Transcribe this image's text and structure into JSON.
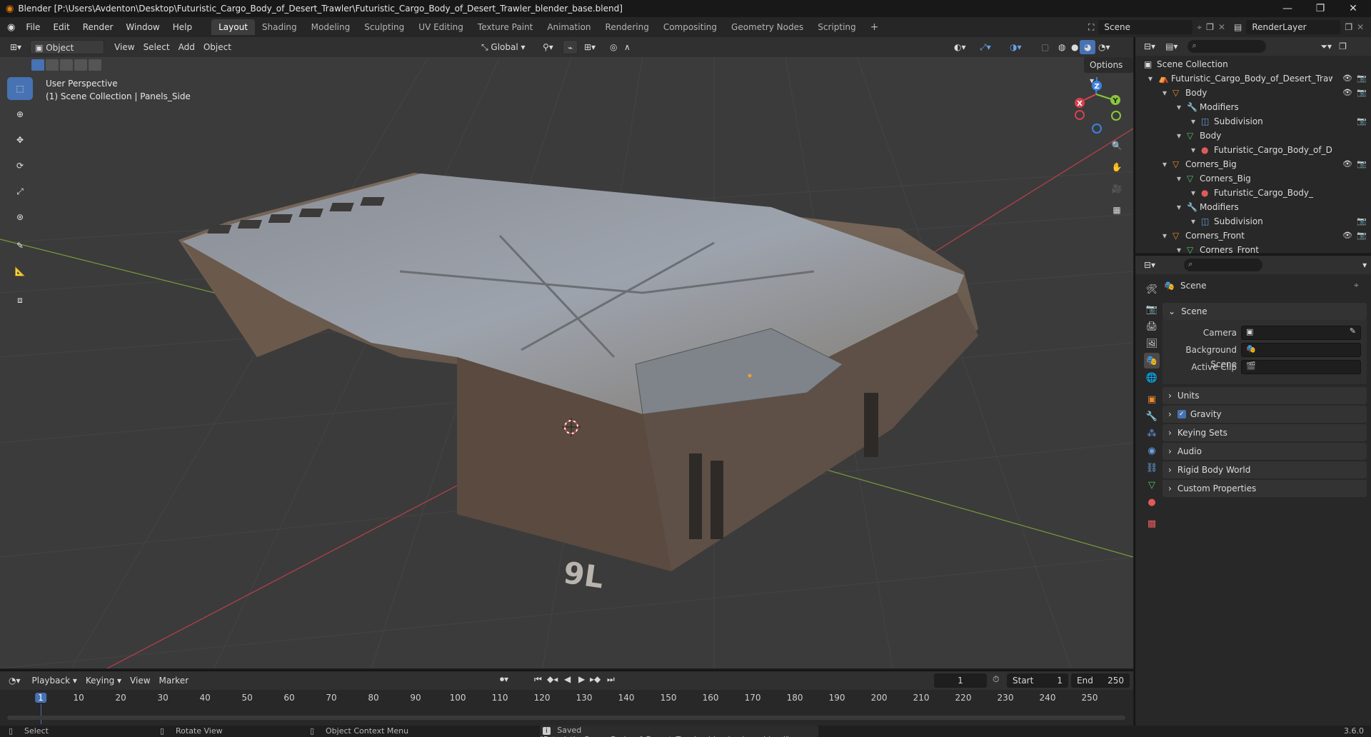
{
  "titlebar": {
    "title": "Blender [P:\\Users\\Avdenton\\Desktop\\Futuristic_Cargo_Body_of_Desert_Trawler\\Futuristic_Cargo_Body_of_Desert_Trawler_blender_base.blend]",
    "minimize": "—",
    "maximize": "❐",
    "close": "✕"
  },
  "menubar": {
    "items": [
      "File",
      "Edit",
      "Render",
      "Window",
      "Help"
    ],
    "workspaces": [
      "Layout",
      "Shading",
      "Modeling",
      "Sculpting",
      "UV Editing",
      "Texture Paint",
      "Animation",
      "Rendering",
      "Compositing",
      "Geometry Nodes",
      "Scripting"
    ],
    "active_workspace": "Layout",
    "add_tab": "+",
    "scene_label": "Scene",
    "render_layer_label": "RenderLayer"
  },
  "viewport_header": {
    "mode": "Object Mode",
    "menus": [
      "View",
      "Select",
      "Add",
      "Object"
    ],
    "transform_orientation": "Global",
    "options_label": "Options"
  },
  "viewport": {
    "perspective_label": "User Perspective",
    "collection_label": "(1) Scene Collection | Panels_Side",
    "gizmo_axes": [
      "X",
      "Y",
      "Z"
    ],
    "decal_text": "9L"
  },
  "outliner": {
    "rows": [
      {
        "label": "Scene Collection",
        "icon": "collection-icon",
        "indent": 0
      },
      {
        "label": "Futuristic_Cargo_Body_of_Desert_Trawl",
        "icon": "object-icon",
        "indent": 1,
        "eye": true,
        "cam": true
      },
      {
        "label": "Body",
        "icon": "mesh-object-icon",
        "indent": 2,
        "eye": true,
        "cam": true
      },
      {
        "label": "Modifiers",
        "icon": "wrench-icon",
        "indent": 3
      },
      {
        "label": "Subdivision",
        "icon": "subdivision-icon",
        "indent": 4,
        "cam": true
      },
      {
        "label": "Body",
        "icon": "mesh-data-icon",
        "indent": 3
      },
      {
        "label": "Futuristic_Cargo_Body_of_D",
        "icon": "material-icon",
        "indent": 4
      },
      {
        "label": "Corners_Big",
        "icon": "mesh-object-icon",
        "indent": 2,
        "eye": true,
        "cam": true
      },
      {
        "label": "Corners_Big",
        "icon": "mesh-data-icon",
        "indent": 3
      },
      {
        "label": "Futuristic_Cargo_Body_",
        "icon": "material-icon",
        "indent": 4
      },
      {
        "label": "Modifiers",
        "icon": "wrench-icon",
        "indent": 3
      },
      {
        "label": "Subdivision",
        "icon": "subdivision-icon",
        "indent": 4,
        "cam": true
      },
      {
        "label": "Corners_Front",
        "icon": "mesh-object-icon",
        "indent": 2,
        "eye": true,
        "cam": true
      },
      {
        "label": "Corners_Front",
        "icon": "mesh-data-icon",
        "indent": 3
      }
    ]
  },
  "properties": {
    "context_title": "Scene",
    "panel_title": "Scene",
    "fields": [
      {
        "label": "Camera",
        "value": ""
      },
      {
        "label": "Background Scene",
        "value": ""
      },
      {
        "label": "Active Clip",
        "value": ""
      }
    ],
    "subpanels": [
      "Units",
      "Gravity",
      "Keying Sets",
      "Audio",
      "Rigid Body World",
      "Custom Properties"
    ],
    "gravity_checked": true
  },
  "timeline": {
    "menus": [
      "Playback",
      "Keying",
      "View",
      "Marker"
    ],
    "current_frame": "1",
    "start_label": "Start",
    "start_value": "1",
    "end_label": "End",
    "end_value": "250",
    "ticks": [
      "1",
      "10",
      "20",
      "30",
      "40",
      "50",
      "60",
      "70",
      "80",
      "90",
      "100",
      "110",
      "120",
      "130",
      "140",
      "150",
      "160",
      "170",
      "180",
      "190",
      "200",
      "210",
      "220",
      "230",
      "240",
      "250"
    ]
  },
  "statusbar": {
    "select": "Select",
    "rotate": "Rotate View",
    "context_menu": "Object Context Menu",
    "message": "Saved \"Futuristic_Cargo_Body_of_Desert_Trawler_blender_base.blend\"",
    "version": "3.6.0"
  },
  "colors": {
    "accent": "#4772b3",
    "x_axis": "#d6404f",
    "y_axis": "#8bc73a",
    "z_axis": "#3b82e0",
    "panel_bg": "#282828",
    "viewport_bg": "#3b3b3b"
  }
}
